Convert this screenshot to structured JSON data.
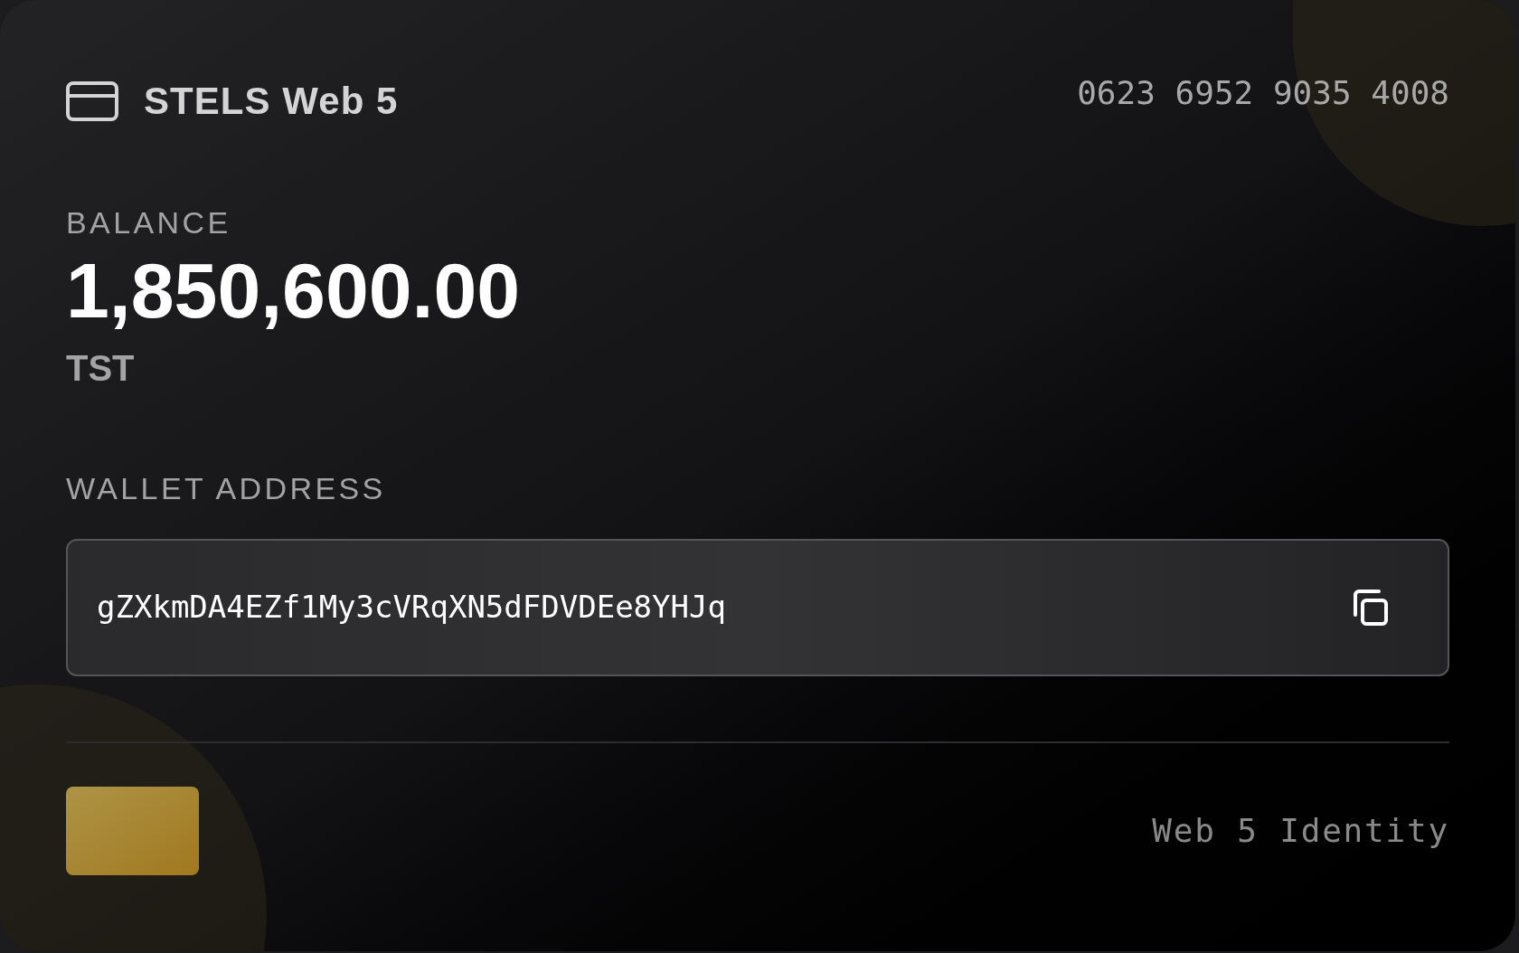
{
  "card": {
    "brand": "STELS Web 5",
    "number": "0623 6952 9035 4008",
    "balance_label": "BALANCE",
    "balance": "1,850,600.00",
    "currency": "TST",
    "address_label": "WALLET ADDRESS",
    "address": "gZXkmDA4EZf1My3cVRqXN5dFDVDEe8YHJq",
    "footer": "Web 5 Identity"
  }
}
